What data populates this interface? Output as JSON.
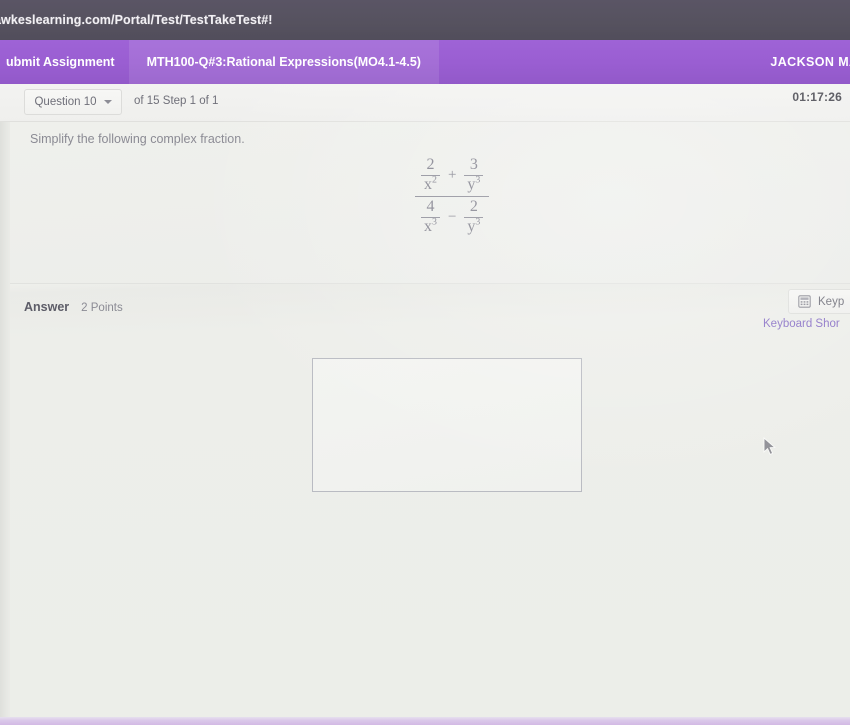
{
  "browser": {
    "url": "awkeslearning.com/Portal/Test/TestTakeTest#!"
  },
  "app_bar": {
    "submit_label": "ubmit Assignment",
    "assignment_tab": "MTH100-Q#3:Rational Expressions(MO4.1-4.5)",
    "user_name": "JACKSON MANG",
    "accent_color": "#9a5ed2"
  },
  "question_toolbar": {
    "question_selector": "Question 10",
    "caret_icon": "chevron-down-icon",
    "step_text": "of 15 Step 1 of 1",
    "timer": "01:17:26"
  },
  "question": {
    "prompt": "Simplify the following complex fraction.",
    "expression": {
      "numerator": {
        "left": {
          "num": "2",
          "den_base": "x",
          "den_exp": "2"
        },
        "operator": "+",
        "right": {
          "num": "3",
          "den_base": "y",
          "den_exp": "3"
        }
      },
      "denominator": {
        "left": {
          "num": "4",
          "den_base": "x",
          "den_exp": "3"
        },
        "operator": "−",
        "right": {
          "num": "2",
          "den_base": "y",
          "den_exp": "3"
        }
      }
    }
  },
  "answer": {
    "label": "Answer",
    "points": "2 Points",
    "keypad_button": "Keyp",
    "keypad_icon": "keypad-icon",
    "keyboard_shortcuts": "Keyboard Shor",
    "input_value": "",
    "input_placeholder": ""
  },
  "cursor": {
    "icon": "mouse-pointer-icon"
  }
}
